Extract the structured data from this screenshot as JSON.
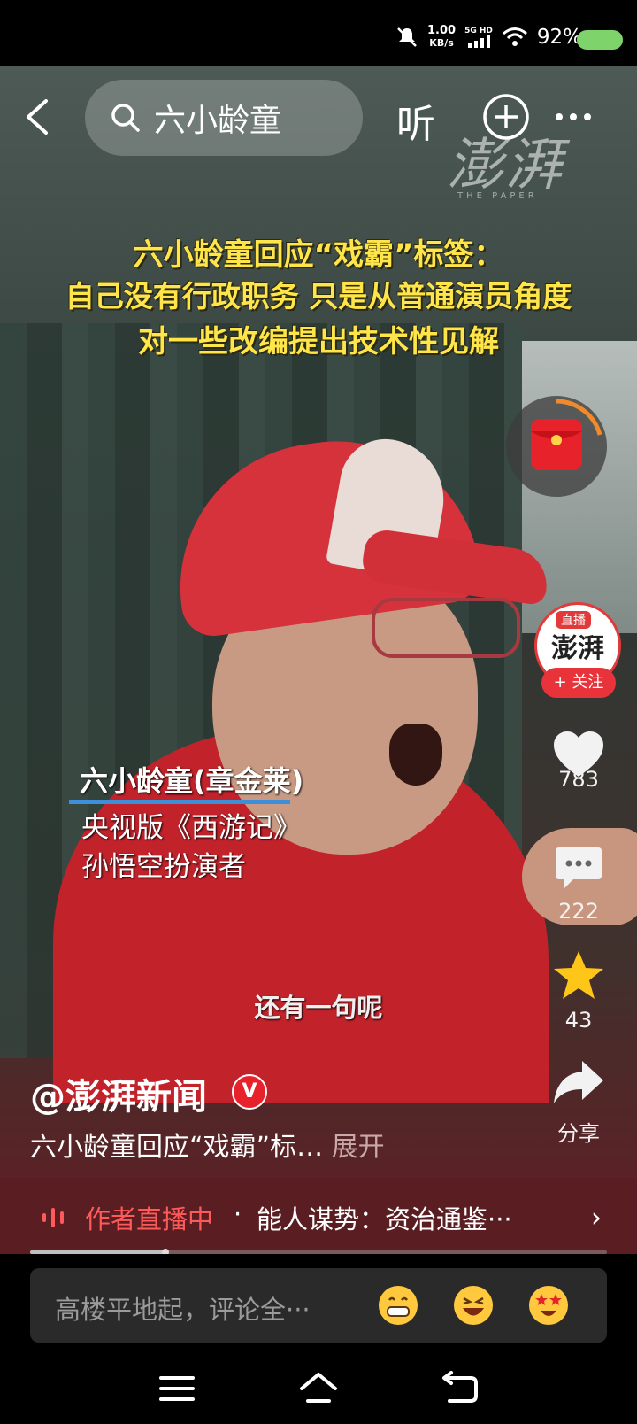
{
  "status_bar": {
    "net_speed_value": "1.00",
    "net_speed_unit": "KB/s",
    "network": "5G HD",
    "battery_pct": "92%",
    "colors": {
      "battery": "#7ed36a"
    }
  },
  "top_bar": {
    "search_query": "六小龄童",
    "listen_label": "听"
  },
  "video": {
    "watermark": "澎湃",
    "watermark_sub": "THE PAPER",
    "headline_lines": [
      "六小龄童回应“戏霸”标签：",
      "自己没有行政职务 只是从普通演员角度",
      "对一些改编提出技术性见解"
    ],
    "caption_name": "六小龄童(章金莱)",
    "caption_sub_1": "央视版《西游记》",
    "caption_sub_2": "孙悟空扮演者",
    "subtitle": "还有一句呢"
  },
  "side_actions": {
    "live_badge": "直播",
    "avatar_text": "澎湃",
    "follow_label": "+ 关注",
    "likes": "783",
    "comments": "222",
    "favorites": "43",
    "share_label": "分享",
    "icons": [
      "heart-icon",
      "comment-icon",
      "star-icon",
      "share-icon"
    ]
  },
  "post": {
    "author": "@澎湃新闻",
    "verified_mark": "V",
    "description": "六小龄童回应“戏霸”标…",
    "expand_label": "展开"
  },
  "live_bar": {
    "status": "作者直播中",
    "separator": "·",
    "topic": "能人谋势：资治通鉴···",
    "chevron": "›"
  },
  "playback": {
    "progress": 0.235
  },
  "comment_bar": {
    "placeholder": "高楼平地起，评论全···",
    "emojis": [
      "grin-emoji",
      "laugh-emoji",
      "star-eyes-emoji"
    ]
  },
  "nav_bar": {
    "icons": [
      "menu-icon",
      "home-icon",
      "back-icon"
    ]
  }
}
